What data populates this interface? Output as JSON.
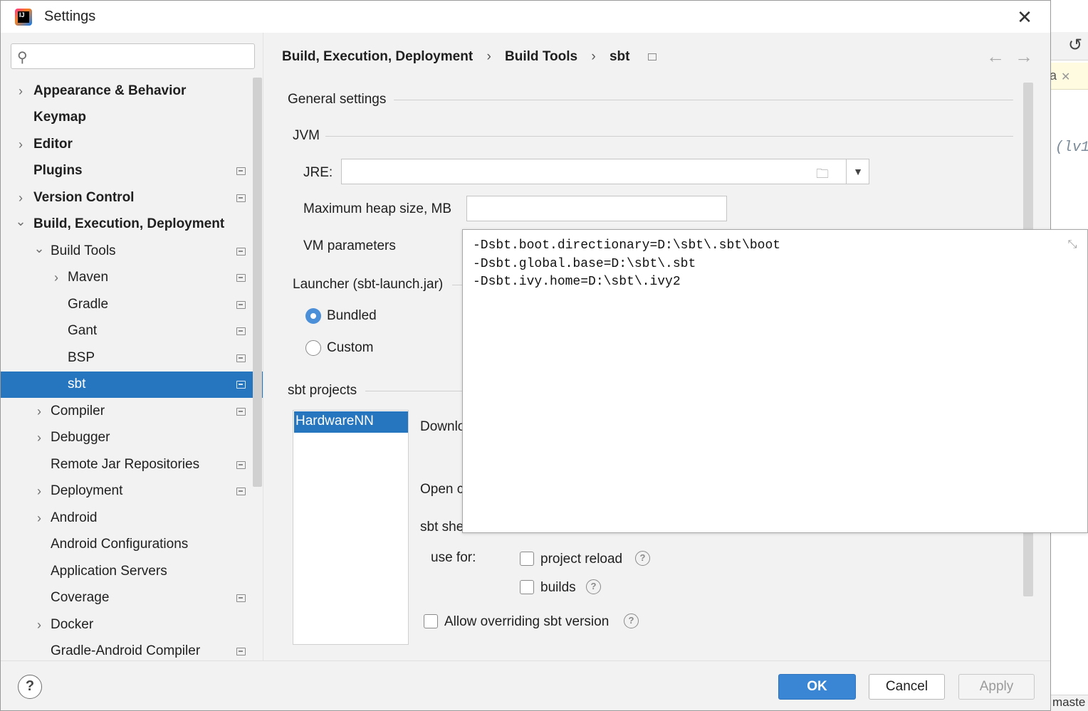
{
  "window": {
    "title": "Settings",
    "close": "✕"
  },
  "search": {
    "placeholder": "",
    "value": ""
  },
  "sidebar": {
    "items": [
      {
        "label": "Appearance & Behavior",
        "chevron": "›"
      },
      {
        "label": "Keymap"
      },
      {
        "label": "Editor",
        "chevron": "›"
      },
      {
        "label": "Plugins"
      },
      {
        "label": "Version Control",
        "chevron": "›"
      },
      {
        "label": "Build, Execution, Deployment",
        "chevron": "⌄"
      },
      {
        "label": "Build Tools",
        "chevron": "⌄"
      },
      {
        "label": "Maven",
        "chevron": "›"
      },
      {
        "label": "Gradle"
      },
      {
        "label": "Gant"
      },
      {
        "label": "BSP"
      },
      {
        "label": "sbt"
      },
      {
        "label": "Compiler",
        "chevron": "›"
      },
      {
        "label": "Debugger",
        "chevron": "›"
      },
      {
        "label": "Remote Jar Repositories"
      },
      {
        "label": "Deployment",
        "chevron": "›"
      },
      {
        "label": "Android",
        "chevron": "›"
      },
      {
        "label": "Android Configurations"
      },
      {
        "label": "Application Servers"
      },
      {
        "label": "Coverage"
      },
      {
        "label": "Docker",
        "chevron": "›"
      },
      {
        "label": "Gradle-Android Compiler"
      }
    ],
    "selected": "sbt"
  },
  "breadcrumb": {
    "items": [
      "Build, Execution, Deployment",
      "Build Tools",
      "sbt"
    ],
    "separator": "›",
    "back": "←",
    "forward": "→"
  },
  "general": {
    "section": "General settings",
    "jvm_section": "JVM",
    "jre_label": "JRE:",
    "jre_value": "",
    "heap_label": "Maximum heap size, MB",
    "heap_value": "",
    "vm_label": "VM parameters",
    "vm_value": "-Dsbt.boot.directionary=D:\\sbt\\.sbt\\boot\n-Dsbt.global.base=D:\\sbt\\.sbt\n-Dsbt.ivy.home=D:\\sbt\\.ivy2",
    "launcher_section": "Launcher (sbt-launch.jar)",
    "bundled_label": "Bundled",
    "custom_label": "Custom"
  },
  "projects": {
    "section": "sbt projects",
    "list": [
      "HardwareNN"
    ],
    "download_label": "Downlo",
    "open_label": "Open c",
    "shell_label": "sbt she",
    "use_for_label": "use for:",
    "project_reload_label": "project reload",
    "builds_label": "builds",
    "allow_override_label": "Allow overriding sbt version",
    "help_glyph": "?"
  },
  "footer": {
    "help": "?",
    "ok": "OK",
    "cancel": "Cancel",
    "apply": "Apply"
  },
  "background_ide": {
    "tab_text": "a",
    "tab_close": "✕",
    "code_text": "(lv1",
    "status_text": "maste",
    "undo": "↺"
  },
  "colors": {
    "accent": "#2675bf",
    "ok_button": "#3a86d4",
    "dialog_bg": "#f2f2f2"
  }
}
